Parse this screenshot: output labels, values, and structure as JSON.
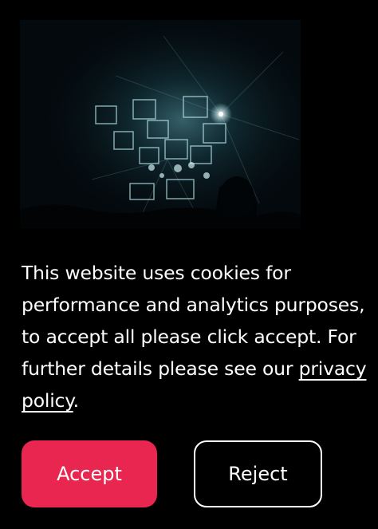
{
  "banner": {
    "hero_image": "concert-stage-lights-photo",
    "message_text": "This website uses cookies for performance and analytics purposes, to accept all please click accept. For further details please see our ",
    "privacy_link_label": "privacy policy",
    "message_suffix": "."
  },
  "actions": {
    "accept_label": "Accept",
    "reject_label": "Reject"
  },
  "colors": {
    "background": "#000000",
    "accent": "#e8264f",
    "text": "#ffffff"
  }
}
